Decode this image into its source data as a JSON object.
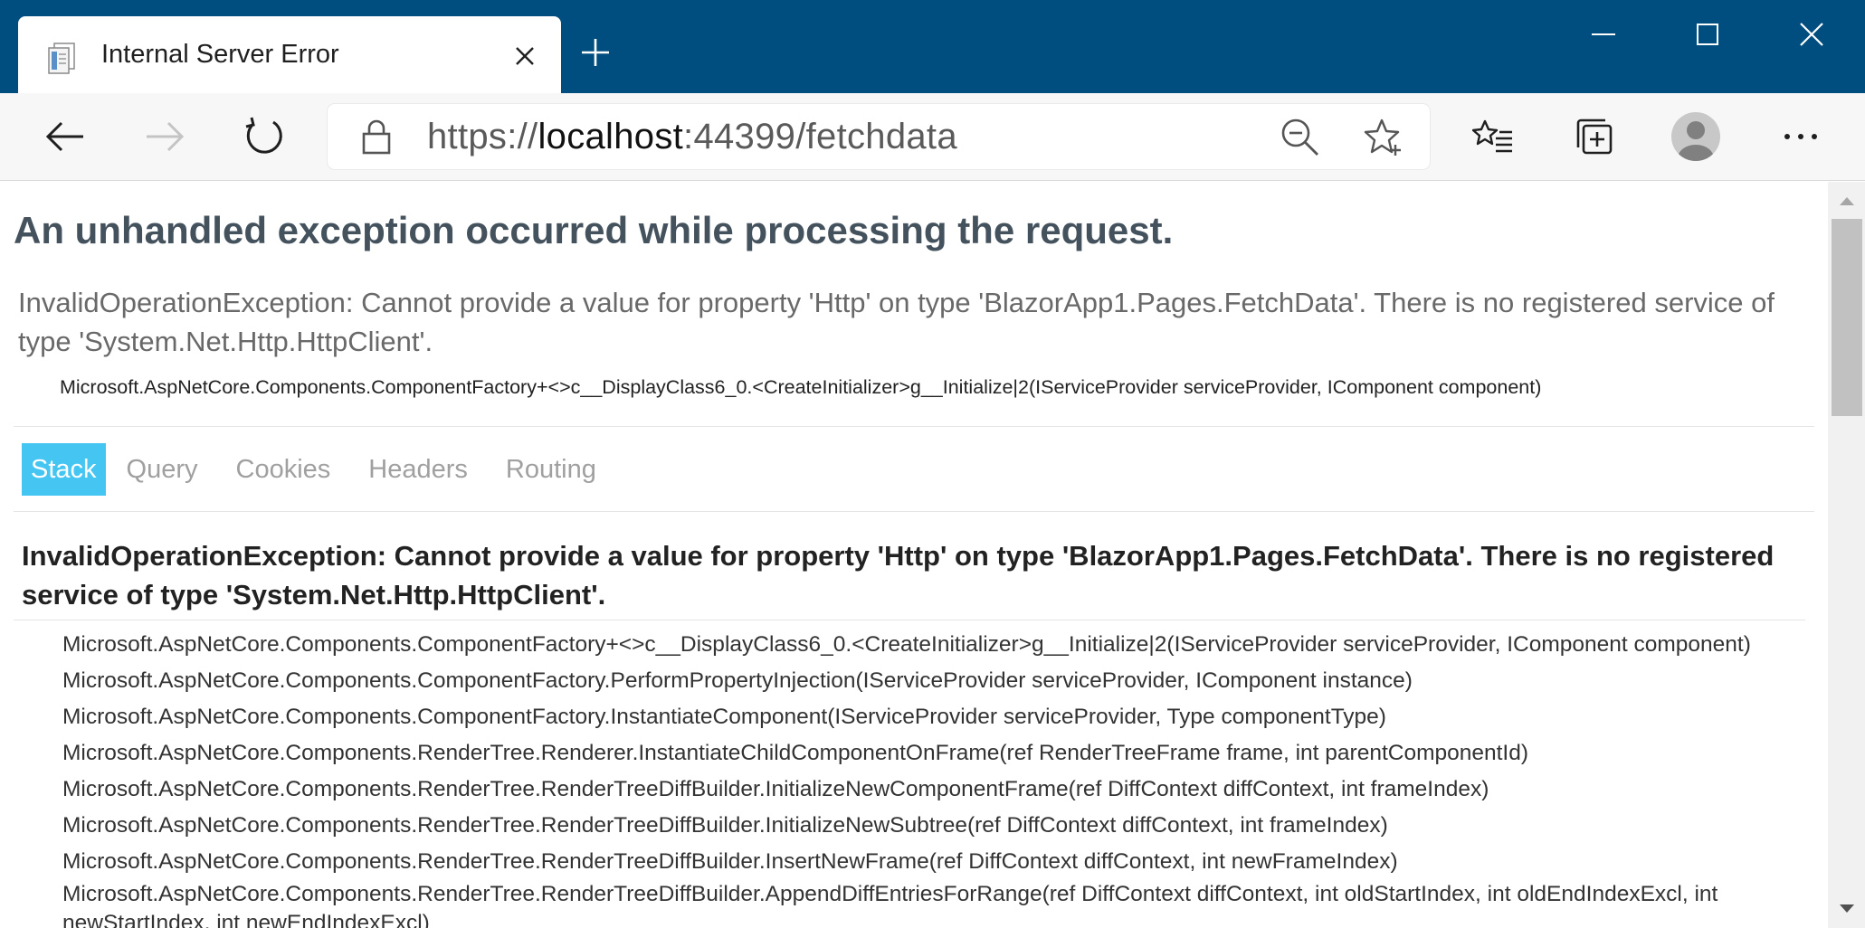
{
  "browser": {
    "tab": {
      "title": "Internal Server Error",
      "favicon": "page-favicon-icon",
      "close_icon": "close-icon"
    },
    "new_tab_icon": "plus-icon",
    "window_controls": [
      "minimize-icon",
      "maximize-icon",
      "close-icon"
    ],
    "nav": {
      "back_icon": "arrow-left-icon",
      "forward_icon": "arrow-right-icon",
      "refresh_icon": "refresh-icon"
    },
    "address": {
      "scheme": "https://",
      "host": "localhost",
      "rest": ":44399/fetchdata",
      "lock_icon": "lock-icon",
      "zoom_icon": "zoom-out-icon",
      "favorite_icon": "star-add-icon"
    },
    "toolbar_icons": [
      "favorites-list-icon",
      "collections-icon",
      "profile-avatar-icon",
      "more-options-icon"
    ],
    "colors": {
      "titlebar": "#004e7f",
      "active_tab_bg": "#44c5f2",
      "heading": "#44525e"
    }
  },
  "page": {
    "heading": "An unhandled exception occurred while processing the request.",
    "title_error": "InvalidOperationException: Cannot provide a value for property 'Http' on type 'BlazorApp1.Pages.FetchData'. There is no registered service of type 'System.Net.Http.HttpClient'.",
    "location": "Microsoft.AspNetCore.Components.ComponentFactory+<>c__DisplayClass6_0.<CreateInitializer>g__Initialize|2(IServiceProvider serviceProvider, IComponent component)",
    "tabs": [
      {
        "label": "Stack",
        "active": true
      },
      {
        "label": "Query",
        "active": false
      },
      {
        "label": "Cookies",
        "active": false
      },
      {
        "label": "Headers",
        "active": false
      },
      {
        "label": "Routing",
        "active": false
      }
    ],
    "stack_title": "InvalidOperationException: Cannot provide a value for property 'Http' on type 'BlazorApp1.Pages.FetchData'. There is no registered service of type 'System.Net.Http.HttpClient'.",
    "frames": [
      "Microsoft.AspNetCore.Components.ComponentFactory+<>c__DisplayClass6_0.<CreateInitializer>g__Initialize|2(IServiceProvider serviceProvider, IComponent component)",
      "Microsoft.AspNetCore.Components.ComponentFactory.PerformPropertyInjection(IServiceProvider serviceProvider, IComponent instance)",
      "Microsoft.AspNetCore.Components.ComponentFactory.InstantiateComponent(IServiceProvider serviceProvider, Type componentType)",
      "Microsoft.AspNetCore.Components.RenderTree.Renderer.InstantiateChildComponentOnFrame(ref RenderTreeFrame frame, int parentComponentId)",
      "Microsoft.AspNetCore.Components.RenderTree.RenderTreeDiffBuilder.InitializeNewComponentFrame(ref DiffContext diffContext, int frameIndex)",
      "Microsoft.AspNetCore.Components.RenderTree.RenderTreeDiffBuilder.InitializeNewSubtree(ref DiffContext diffContext, int frameIndex)",
      "Microsoft.AspNetCore.Components.RenderTree.RenderTreeDiffBuilder.InsertNewFrame(ref DiffContext diffContext, int newFrameIndex)",
      "Microsoft.AspNetCore.Components.RenderTree.RenderTreeDiffBuilder.AppendDiffEntriesForRange(ref DiffContext diffContext, int oldStartIndex, int oldEndIndexExcl, int newStartIndex, int newEndIndexExcl)"
    ]
  }
}
